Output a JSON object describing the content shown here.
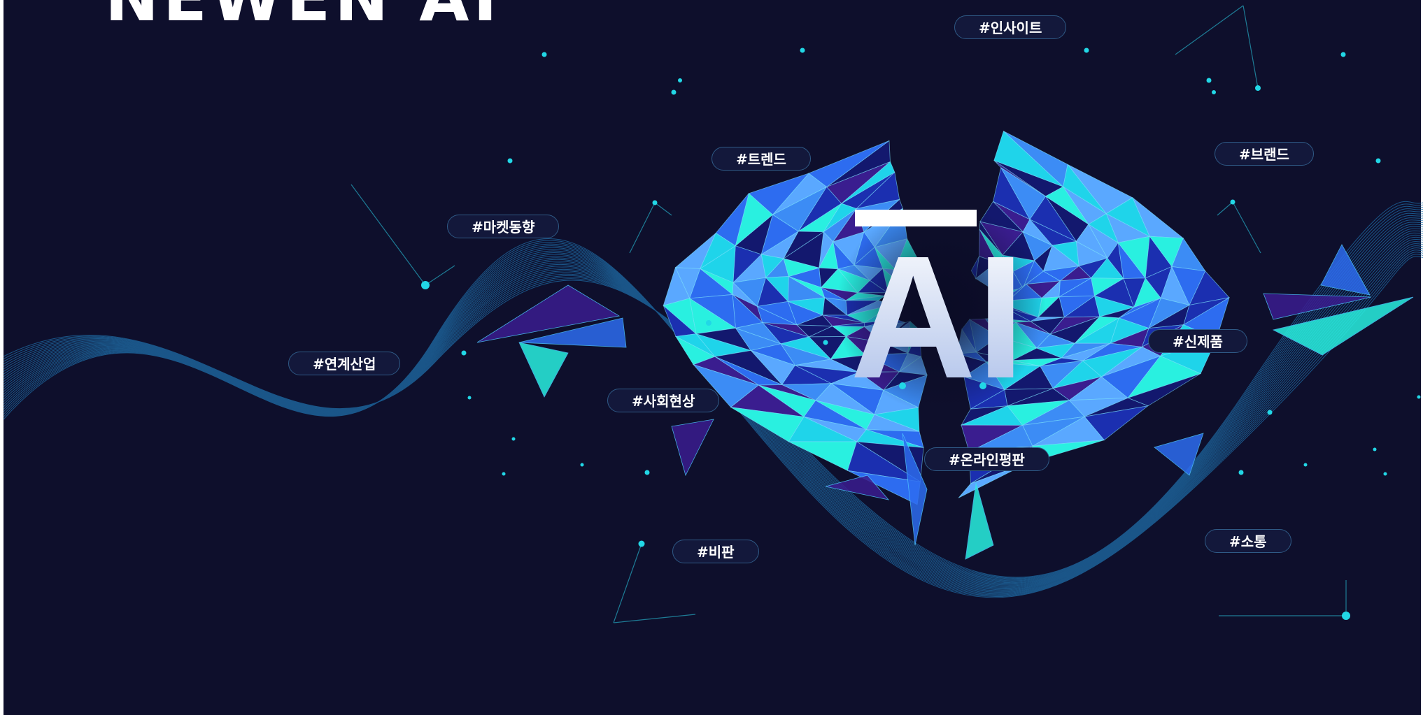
{
  "brand": {
    "logo_text": "NEWEN AI"
  },
  "hero": {
    "center_text": "AI"
  },
  "tags": [
    "#인사이트",
    "#트렌드",
    "#브랜드",
    "#마켓동향",
    "#연계산업",
    "#사회현상",
    "#신제품",
    "#온라인평판",
    "#비판",
    "#소통"
  ],
  "colors": {
    "background": "#0e0f2c",
    "accent_cyan": "#29f0e0",
    "accent_blue": "#2d6cf0",
    "accent_purple": "#3a1d8f",
    "tag_border": "#2f5a86"
  }
}
